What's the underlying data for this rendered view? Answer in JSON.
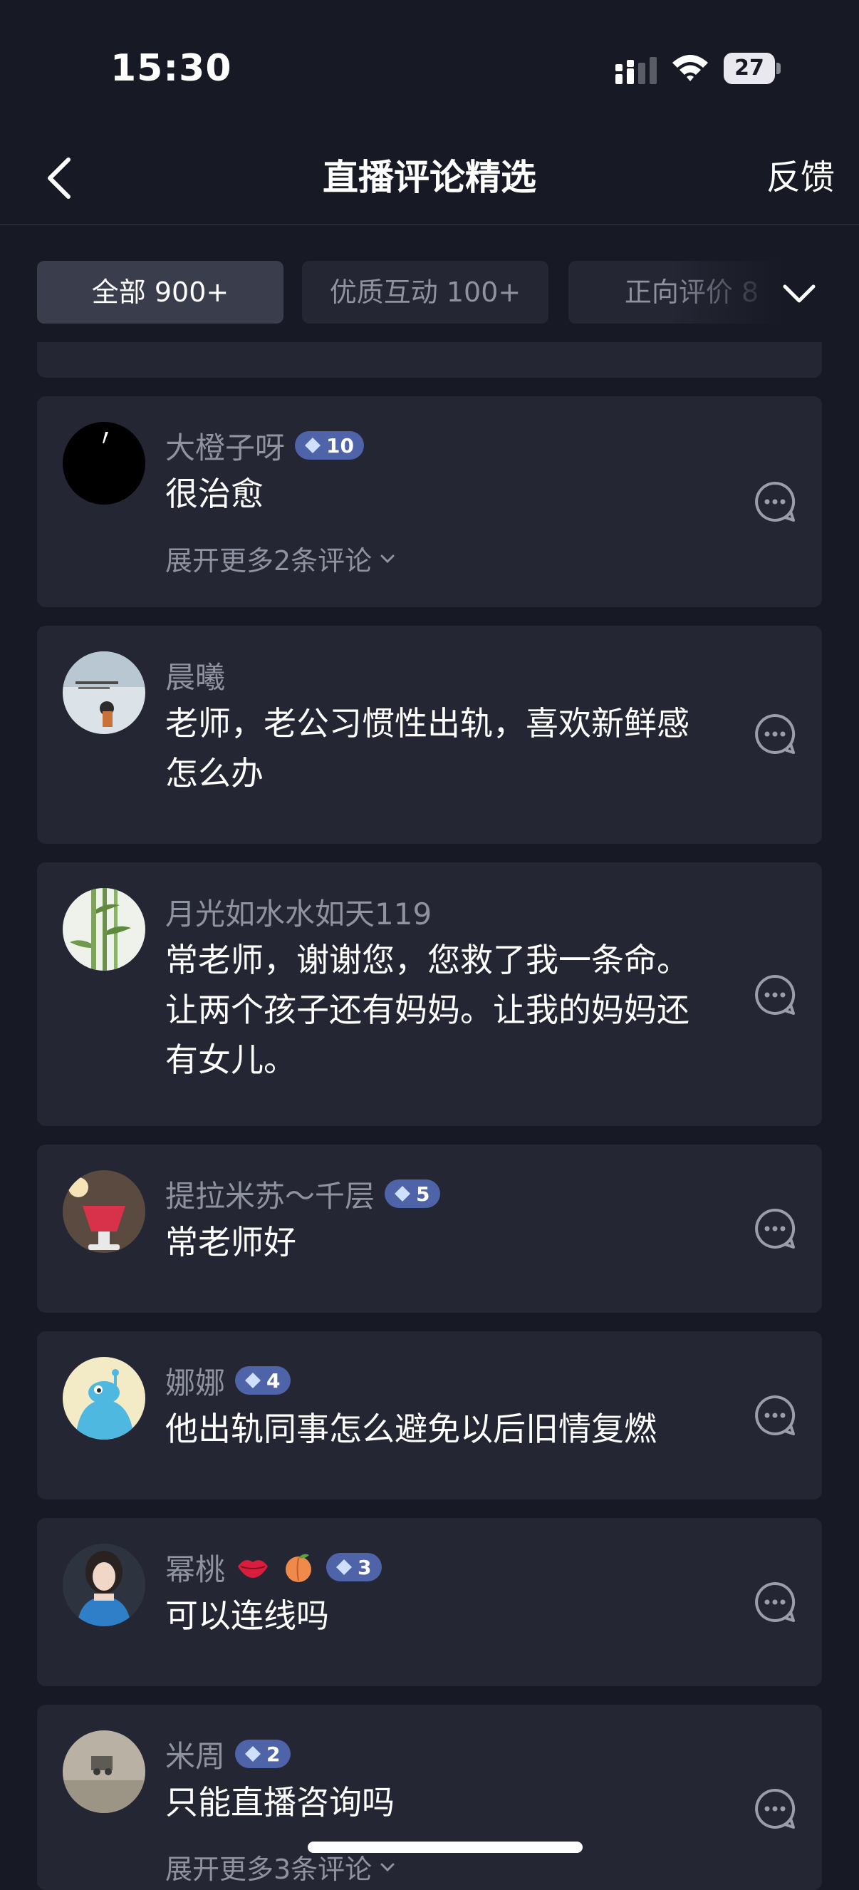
{
  "status_bar": {
    "time": "15:30",
    "battery": "27"
  },
  "header": {
    "title": "直播评论精选",
    "feedback_label": "反馈"
  },
  "filters": [
    {
      "label": "全部 900+",
      "active": true
    },
    {
      "label": "优质互动 100+",
      "active": false
    },
    {
      "label": "正向评价 8",
      "active": false
    }
  ],
  "comments": [
    {
      "name": "大橙子呀",
      "level": "10",
      "text": "很治愈",
      "expand_label": "展开更多2条评论"
    },
    {
      "name": "晨曦",
      "level": "",
      "text": "老师，老公习惯性出轨，喜欢新鲜感怎么办",
      "expand_label": ""
    },
    {
      "name": "月光如水水如天119",
      "level": "",
      "text": "常老师，谢谢您，您救了我一条命。让两个孩子还有妈妈。让我的妈妈还有女儿。",
      "expand_label": ""
    },
    {
      "name": "提拉米苏～千层",
      "level": "5",
      "text": "常老师好",
      "expand_label": ""
    },
    {
      "name": "娜娜",
      "level": "4",
      "text": "他出轨同事怎么避免以后旧情复燃",
      "expand_label": ""
    },
    {
      "name": "幂桃",
      "level": "3",
      "text": "可以连线吗",
      "expand_label": "",
      "emojis": [
        "kiss-lips-icon",
        "peach-icon"
      ]
    },
    {
      "name": "米周",
      "level": "2",
      "text": "只能直播咨询吗",
      "expand_label": "展开更多3条评论"
    }
  ],
  "colors": {
    "background": "#171924",
    "card": "#242633",
    "badge": "#4F63A8",
    "muted_text": "#8F92A0"
  }
}
